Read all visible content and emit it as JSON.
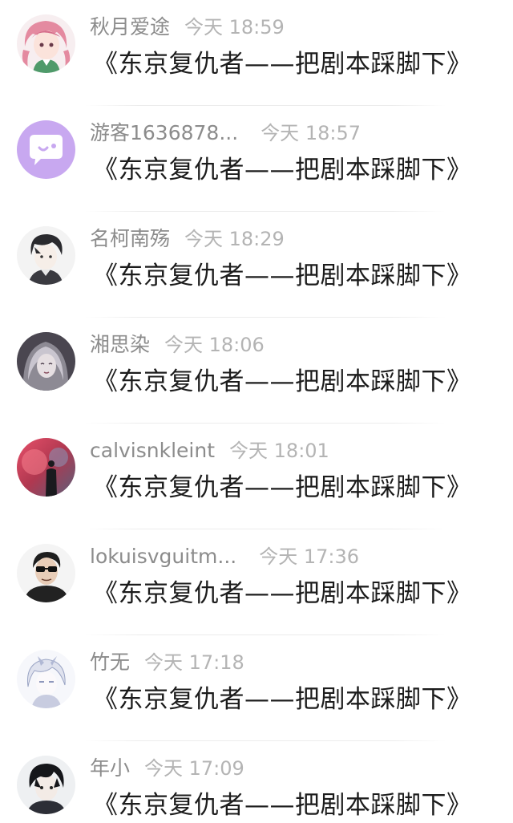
{
  "comments": [
    {
      "user": "秋月爱途",
      "time": "今天 18:59",
      "text": "《东京复仇者——把剧本踩脚下》",
      "avatar": "anime-girl-pink-hair-avatar"
    },
    {
      "user": "游客1636878...",
      "time": "今天 18:57",
      "text": "《东京复仇者——把剧本踩脚下》",
      "avatar": "guest-chat-bubble-avatar"
    },
    {
      "user": "名柯南殇",
      "time": "今天 18:29",
      "text": "《东京复仇者——把剧本踩脚下》",
      "avatar": "anime-boy-dark-hair-avatar"
    },
    {
      "user": "湘思染",
      "time": "今天 18:06",
      "text": "《东京复仇者——把剧本踩脚下》",
      "avatar": "anime-girl-white-hair-avatar"
    },
    {
      "user": "calvisnkleint",
      "time": "今天 18:01",
      "text": "《东京复仇者——把剧本踩脚下》",
      "avatar": "silhouette-smoke-avatar"
    },
    {
      "user": "lokuisvguitm...",
      "time": "今天 17:36",
      "text": "《东京复仇者——把剧本踩脚下》",
      "avatar": "man-sunglasses-avatar"
    },
    {
      "user": "竹无",
      "time": "今天 17:18",
      "text": "《东京复仇者——把剧本踩脚下》",
      "avatar": "anime-white-hair-sketch-avatar"
    },
    {
      "user": "年小",
      "time": "今天 17:09",
      "text": "《东京复仇者——把剧本踩脚下》",
      "avatar": "anime-boy-black-hair-avatar"
    }
  ],
  "colors": {
    "username": "#8c8c8c",
    "timestamp": "#b4b4b4",
    "message": "#1c1c1c",
    "guest_avatar": "#c8a8f0"
  }
}
